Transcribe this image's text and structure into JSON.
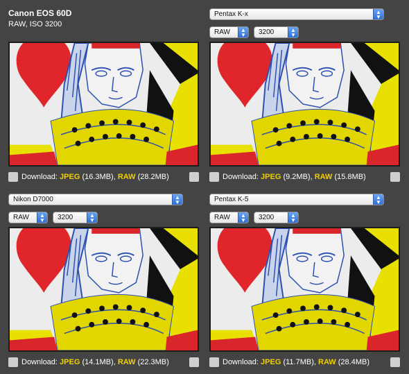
{
  "panels": [
    {
      "title": "Canon EOS 60D",
      "subtitle": "RAW, ISO 3200",
      "camera": "",
      "format": "",
      "iso": "",
      "download": {
        "label": "Download:",
        "jpeg": "JPEG",
        "jpeg_size": "(16.3MB),",
        "raw": "RAW",
        "raw_size": "(28.2MB)"
      }
    },
    {
      "title": "",
      "subtitle": "",
      "camera": "Pentax K-x",
      "format": "RAW",
      "iso": "3200",
      "download": {
        "label": "Download:",
        "jpeg": "JPEG",
        "jpeg_size": "(9.2MB),",
        "raw": "RAW",
        "raw_size": "(15.8MB)"
      }
    },
    {
      "title": "",
      "subtitle": "",
      "camera": "Nikon D7000",
      "format": "RAW",
      "iso": "3200",
      "download": {
        "label": "Download:",
        "jpeg": "JPEG",
        "jpeg_size": "(14.1MB),",
        "raw": "RAW",
        "raw_size": "(22.3MB)"
      }
    },
    {
      "title": "",
      "subtitle": "",
      "camera": "Pentax K-5",
      "format": "RAW",
      "iso": "3200",
      "download": {
        "label": "Download:",
        "jpeg": "JPEG",
        "jpeg_size": "(11.7MB),",
        "raw": "RAW",
        "raw_size": "(28.4MB)"
      }
    }
  ],
  "icons": {
    "download": "download-icon",
    "settings": "gear-icon",
    "dropdown": "chevron-updown-icon"
  },
  "colors": {
    "background": "#444444",
    "highlight": "#f0d000",
    "select_arrow": "#3b7ae0"
  }
}
